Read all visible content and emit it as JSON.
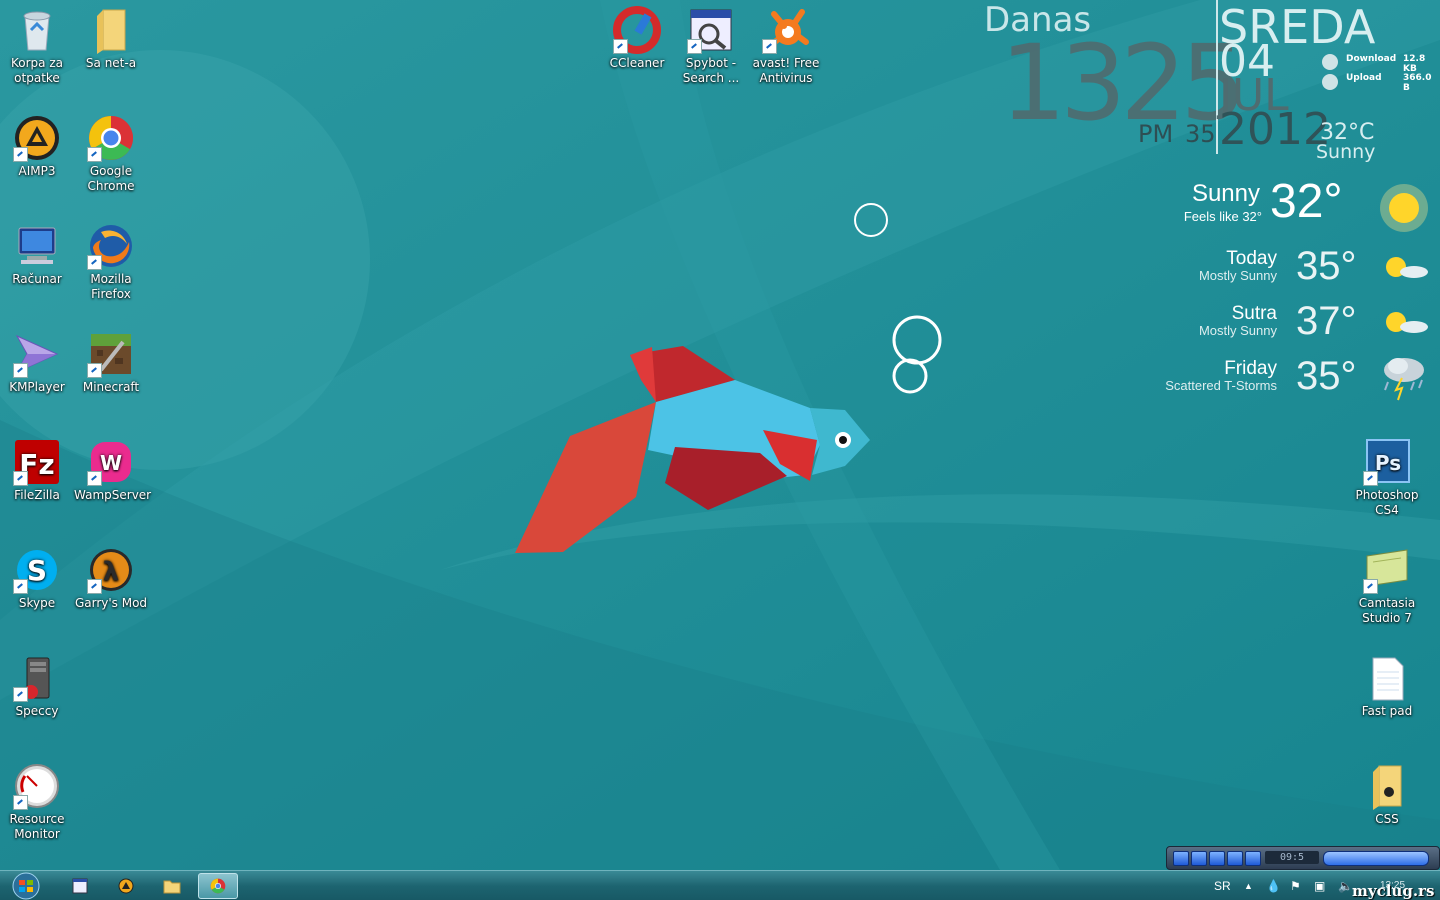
{
  "desktop_left": [
    {
      "label": "Korpa za otpatke",
      "icon": "recycle-bin-icon"
    },
    {
      "label": "Sa net-a",
      "icon": "folder-icon"
    },
    {
      "label": "AIMP3",
      "icon": "aimp-icon"
    },
    {
      "label": "Google Chrome",
      "icon": "chrome-icon"
    },
    {
      "label": "Računar",
      "icon": "computer-icon"
    },
    {
      "label": "Mozilla Firefox",
      "icon": "firefox-icon"
    },
    {
      "label": "KMPlayer",
      "icon": "kmplayer-icon"
    },
    {
      "label": "Minecraft",
      "icon": "minecraft-icon"
    },
    {
      "label": "FileZilla",
      "icon": "filezilla-icon"
    },
    {
      "label": "WampServer",
      "icon": "wampserver-icon"
    },
    {
      "label": "Skype",
      "icon": "skype-icon"
    },
    {
      "label": "Garry's Mod",
      "icon": "garrys-mod-icon"
    },
    {
      "label": "Speccy",
      "icon": "speccy-icon"
    },
    {
      "label": "Resource Monitor",
      "icon": "resource-monitor-icon"
    }
  ],
  "desktop_top": [
    {
      "label": "CCleaner",
      "icon": "ccleaner-icon"
    },
    {
      "label": "Spybot - Search ...",
      "icon": "spybot-icon"
    },
    {
      "label": "avast! Free Antivirus",
      "icon": "avast-icon"
    }
  ],
  "desktop_right": [
    {
      "label": "Photoshop CS4",
      "icon": "photoshop-icon"
    },
    {
      "label": "Camtasia Studio 7",
      "icon": "camtasia-icon"
    },
    {
      "label": "Fast pad",
      "icon": "text-file-icon"
    },
    {
      "label": "CSS",
      "icon": "folder-icon"
    }
  ],
  "clock": {
    "label": "Danas",
    "time": "1325",
    "ampm": "PM",
    "seconds": "35",
    "day": "SREDA",
    "date": "04",
    "month": "JUL",
    "year": "2012",
    "temp": "32°C",
    "cond": "Sunny"
  },
  "network": {
    "download_label": "Download",
    "download_value": "12.8 KB",
    "upload_label": "Upload",
    "upload_value": "366.0 B"
  },
  "weather": {
    "current": {
      "cond": "Sunny",
      "feels": "Feels like 32°",
      "temp": "32°"
    },
    "forecast": [
      {
        "day": "Today",
        "cond": "Mostly Sunny",
        "temp": "35°",
        "icon": "partly-sunny-icon"
      },
      {
        "day": "Sutra",
        "cond": "Mostly Sunny",
        "temp": "37°",
        "icon": "partly-sunny-icon"
      },
      {
        "day": "Friday",
        "cond": "Scattered T-Storms",
        "temp": "35°",
        "icon": "thunderstorm-icon"
      }
    ]
  },
  "media": {
    "time": "09:5"
  },
  "taskbar": {
    "lang": "SR",
    "clock": "13:25",
    "watermark": "myclug.rs"
  },
  "colors": {
    "wallpaper": "#1f8f97",
    "fish_body": "#4cc3e6",
    "fish_fin": "#c0282d",
    "fish_tail": "#d9483a"
  }
}
